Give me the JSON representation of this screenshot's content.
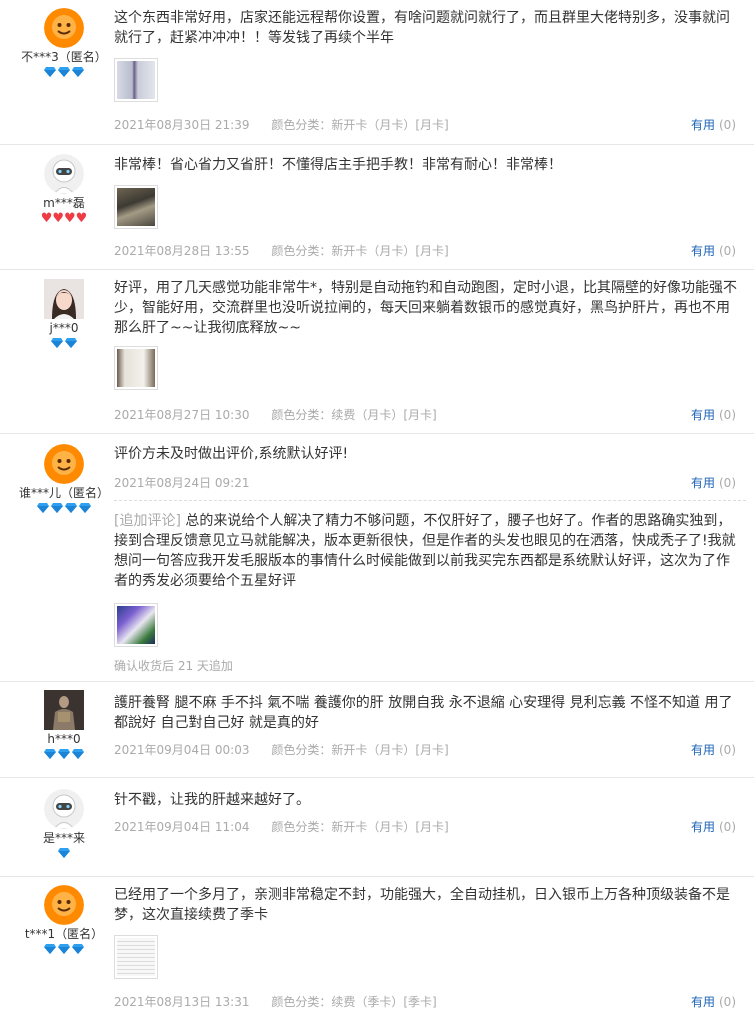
{
  "reviews": [
    {
      "user": "不***3（匿名）",
      "avatar": "orange-mascot-avatar",
      "badge_type": "diamond",
      "badge_count": 3,
      "text": "这个东西非常好用，店家还能远程帮你设置，有啥问题就问就行了，而且群里大佬特别多，没事就问就行了，赶紧冲冲冲！！等发钱了再续个半年",
      "date": "2021年08月30日 21:39",
      "category": "颜色分类：新开卡（月卡）[月卡]",
      "useful_label": "有用",
      "useful_count": "(0)"
    },
    {
      "user": "m***磊",
      "avatar": "white-robot-avatar",
      "badge_type": "heart",
      "badge_count": 4,
      "text": "非常棒！省心省力又省肝！不懂得店主手把手教！非常有耐心！非常棒！",
      "date": "2021年08月28日 13:55",
      "category": "颜色分类：新开卡（月卡）[月卡]",
      "useful_label": "有用",
      "useful_count": "(0)"
    },
    {
      "user": "j***0",
      "avatar": "girl-photo-avatar",
      "badge_type": "diamond",
      "badge_count": 2,
      "text": "好评，用了几天感觉功能非常牛*，特别是自动拖钓和自动跑图，定时小退，比其隔壁的好像功能强不少，智能好用，交流群里也没听说拉闸的，每天回来躺着数银币的感觉真好，黑鸟护肝片，再也不用那么肝了~~让我彻底释放~~",
      "date": "2021年08月27日 10:30",
      "category": "颜色分类：续费（月卡）[月卡]",
      "useful_label": "有用",
      "useful_count": "(0)"
    },
    {
      "user": "谁***儿（匿名）",
      "avatar": "orange-mascot-avatar",
      "badge_type": "diamond",
      "badge_count": 4,
      "text": "评价方未及时做出评价,系统默认好评!",
      "date": "2021年08月24日 09:21",
      "category": "",
      "useful_label": "有用",
      "useful_count": "(0)",
      "append_tag": "[追加评论]",
      "append_text": "总的来说给个人解决了精力不够问题，不仅肝好了，腰子也好了。作者的思路确实独到，接到合理反馈意见立马就能解决，版本更新很快，但是作者的头发也眼见的在洒落，快成秃子了!我就想问一句答应我开发毛服版本的事情什么时候能做到以前我买完东西都是系统默认好评，这次为了作者的秀发必须要给个五星好评",
      "append_after": "确认收货后 21 天追加"
    },
    {
      "user": "h***0",
      "avatar": "figure-photo-avatar",
      "badge_type": "diamond",
      "badge_count": 3,
      "text": "護肝養腎 腿不麻 手不抖 氣不喘 養護你的肝 放開自我 永不退縮 心安理得 見利忘義 不怪不知道 用了都說好 自己對自己好 就是真的好",
      "date": "2021年09月04日 00:03",
      "category": "颜色分类：新开卡（月卡）[月卡]",
      "useful_label": "有用",
      "useful_count": "(0)"
    },
    {
      "user": "是***来",
      "avatar": "white-robot-avatar",
      "badge_type": "diamond",
      "badge_count": 1,
      "text": "针不戳，让我的肝越来越好了。",
      "date": "2021年09月04日 11:04",
      "category": "颜色分类：新开卡（月卡）[月卡]",
      "useful_label": "有用",
      "useful_count": "(0)"
    },
    {
      "user": "t***1（匿名）",
      "avatar": "orange-mascot-avatar",
      "badge_type": "diamond",
      "badge_count": 3,
      "text": "已经用了一个多月了，亲测非常稳定不封，功能强大，全自动挂机，日入银币上万各种顶级装备不是梦，这次直接续费了季卡",
      "date": "2021年08月13日 13:31",
      "category": "颜色分类：续费（季卡）[季卡]",
      "useful_label": "有用",
      "useful_count": "(0)"
    }
  ],
  "colors": {
    "link": "#1c63b7",
    "meta": "#aaaaaa",
    "diamond": "#2f9ff0",
    "heart": "#ef3b44",
    "divider": "#e6e6e6"
  }
}
